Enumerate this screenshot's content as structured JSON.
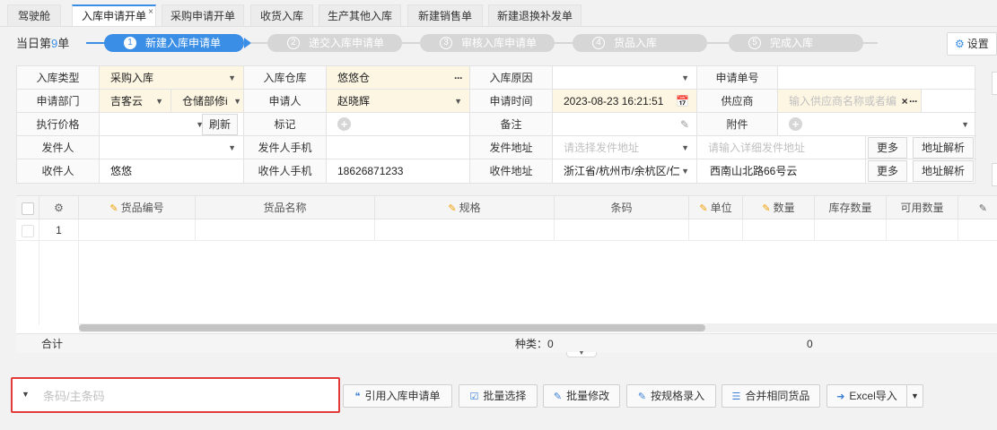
{
  "tabs": [
    {
      "label": "驾驶舱"
    },
    {
      "label": "入库申请开单",
      "close": "×"
    },
    {
      "label": "采购申请开单"
    },
    {
      "label": "收货入库"
    },
    {
      "label": "生产其他入库"
    },
    {
      "label": "新建销售单"
    },
    {
      "label": "新建退换补发单"
    }
  ],
  "header": {
    "day_prefix": "当日第",
    "day_count": "9",
    "day_suffix": "单",
    "settings_label": "设置"
  },
  "steps": [
    {
      "num": "1",
      "label": "新建入库申请单",
      "active": true
    },
    {
      "num": "2",
      "label": "递交入库申请单",
      "active": false
    },
    {
      "num": "3",
      "label": "审核入库申请单",
      "active": false
    },
    {
      "num": "4",
      "label": "货品入库",
      "active": false
    },
    {
      "num": "5",
      "label": "完成入库",
      "active": false
    }
  ],
  "form": {
    "inbound_type": {
      "label": "入库类型",
      "value": "采购入库"
    },
    "warehouse": {
      "label": "入库仓库",
      "value": "悠悠仓"
    },
    "reason": {
      "label": "入库原因",
      "value": ""
    },
    "request_no": {
      "label": "申请单号",
      "value": ""
    },
    "dept": {
      "label": "申请部门",
      "value": "吉客云",
      "value2": "仓储部修i"
    },
    "applicant": {
      "label": "申请人",
      "value": "赵晓辉"
    },
    "apply_time": {
      "label": "申请时间",
      "value": "2023-08-23 16:21:51"
    },
    "supplier": {
      "label": "供应商",
      "placeholder": "输入供应商名称或者编"
    },
    "price": {
      "label": "执行价格",
      "value": "",
      "refresh": "刷新"
    },
    "mark": {
      "label": "标记"
    },
    "remark": {
      "label": "备注",
      "value": ""
    },
    "attachment": {
      "label": "附件"
    },
    "sender": {
      "label": "发件人",
      "value": ""
    },
    "sender_phone": {
      "label": "发件人手机",
      "value": ""
    },
    "sender_addr": {
      "label": "发件地址",
      "placeholder": "请选择发件地址",
      "detail_placeholder": "请输入详细发件地址"
    },
    "receiver": {
      "label": "收件人",
      "value": "悠悠"
    },
    "receiver_phone": {
      "label": "收件人手机",
      "value": "18626871233"
    },
    "receiver_addr": {
      "label": "收件地址",
      "value": "浙江省/杭州市/余杭区/仁",
      "detail": "西南山北路66号云"
    },
    "more": "更多",
    "parse": "地址解析"
  },
  "grid": {
    "columns": [
      "货品编号",
      "货品名称",
      "规格",
      "条码",
      "单位",
      "数量",
      "库存数量",
      "可用数量"
    ],
    "row_numbers": [
      "1"
    ],
    "totals": {
      "label": "合计",
      "kinds_label": "种类：",
      "kinds": "0",
      "qty": "0"
    }
  },
  "bottom": {
    "barcode_placeholder": "条码/主条码",
    "buttons": [
      "引用入库申请单",
      "批量选择",
      "批量修改",
      "按规格录入",
      "合并相同货品",
      "Excel导入"
    ]
  },
  "colors": {
    "accent": "#3a8ee6",
    "alert": "#e03a3a",
    "highlight": "#fdf6e3"
  },
  "icons": [
    "gear-icon",
    "close-icon",
    "caret-down-icon",
    "ellipsis-icon",
    "calendar-icon",
    "edit-icon",
    "plus-icon",
    "pencil-icon",
    "quote-icon",
    "checkbox-icon",
    "excel-import-icon",
    "database-icon"
  ]
}
